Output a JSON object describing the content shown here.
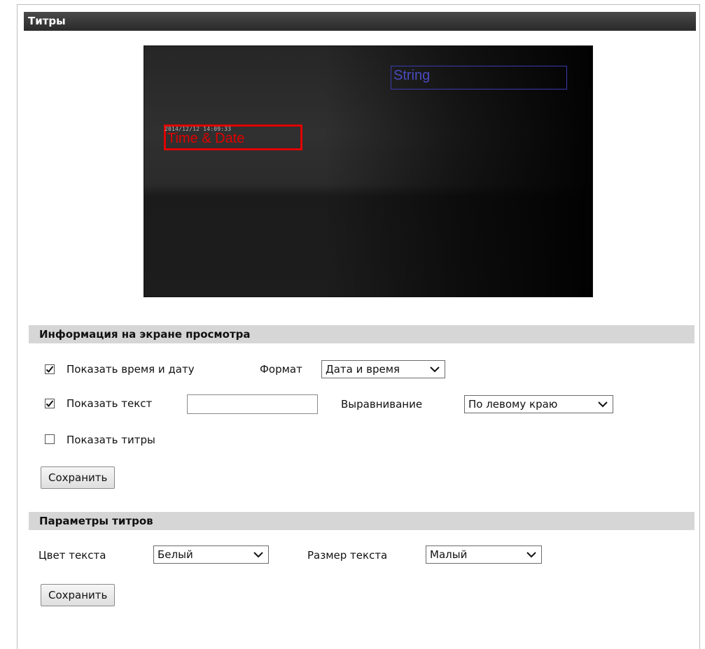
{
  "page": {
    "title": "Титры"
  },
  "preview": {
    "string_overlay": "String",
    "timestamp": "2014/12/12 14:09:33",
    "datetime_overlay": "Time & Date"
  },
  "osd": {
    "header": "Информация на экране просмотра",
    "show_datetime_label": "Показать время и дату",
    "show_datetime_checked": true,
    "format_label": "Формат",
    "format_value": "Дата и время",
    "show_text_label": "Показать текст",
    "show_text_checked": true,
    "text_value": "",
    "alignment_label": "Выравнивание",
    "alignment_value": "По левому краю",
    "show_titles_label": "Показать титры",
    "show_titles_checked": false,
    "save_label": "Сохранить"
  },
  "title_params": {
    "header": "Параметры титров",
    "text_color_label": "Цвет текста",
    "text_color_value": "Белый",
    "text_size_label": "Размер текста",
    "text_size_value": "Малый",
    "save_label": "Сохранить"
  },
  "icons": {
    "check": "checkmark-icon",
    "dropdown": "chevron-down-icon"
  }
}
